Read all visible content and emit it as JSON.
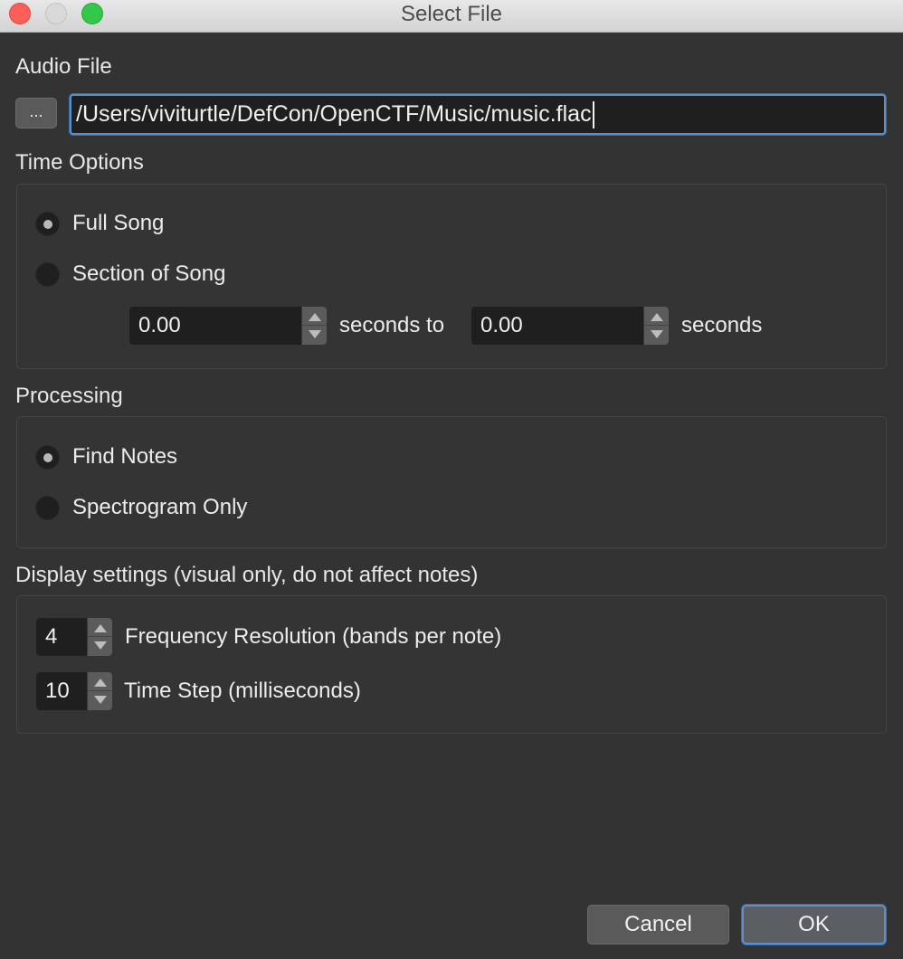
{
  "window": {
    "title": "Select File"
  },
  "audio_file": {
    "heading": "Audio File",
    "browse_label": "...",
    "path_value": "/Users/viviturtle/DefCon/OpenCTF/Music/music.flac"
  },
  "time_options": {
    "heading": "Time Options",
    "full_song_label": "Full Song",
    "section_label": "Section of Song",
    "selected": "Full Song",
    "start_value": "0.00",
    "between_label": "seconds to",
    "end_value": "0.00",
    "end_label": "seconds"
  },
  "processing": {
    "heading": "Processing",
    "find_notes_label": "Find Notes",
    "spectrogram_label": "Spectrogram Only",
    "selected": "Find Notes"
  },
  "display_settings": {
    "heading": "Display settings (visual only, do not affect notes)",
    "frequency_value": "4",
    "frequency_label": "Frequency Resolution (bands per note)",
    "timestep_value": "10",
    "timestep_label": "Time Step (milliseconds)"
  },
  "buttons": {
    "cancel": "Cancel",
    "ok": "OK"
  },
  "colors": {
    "accent": "#5d8fc8",
    "background": "#333333",
    "field": "#1f1f1f"
  }
}
